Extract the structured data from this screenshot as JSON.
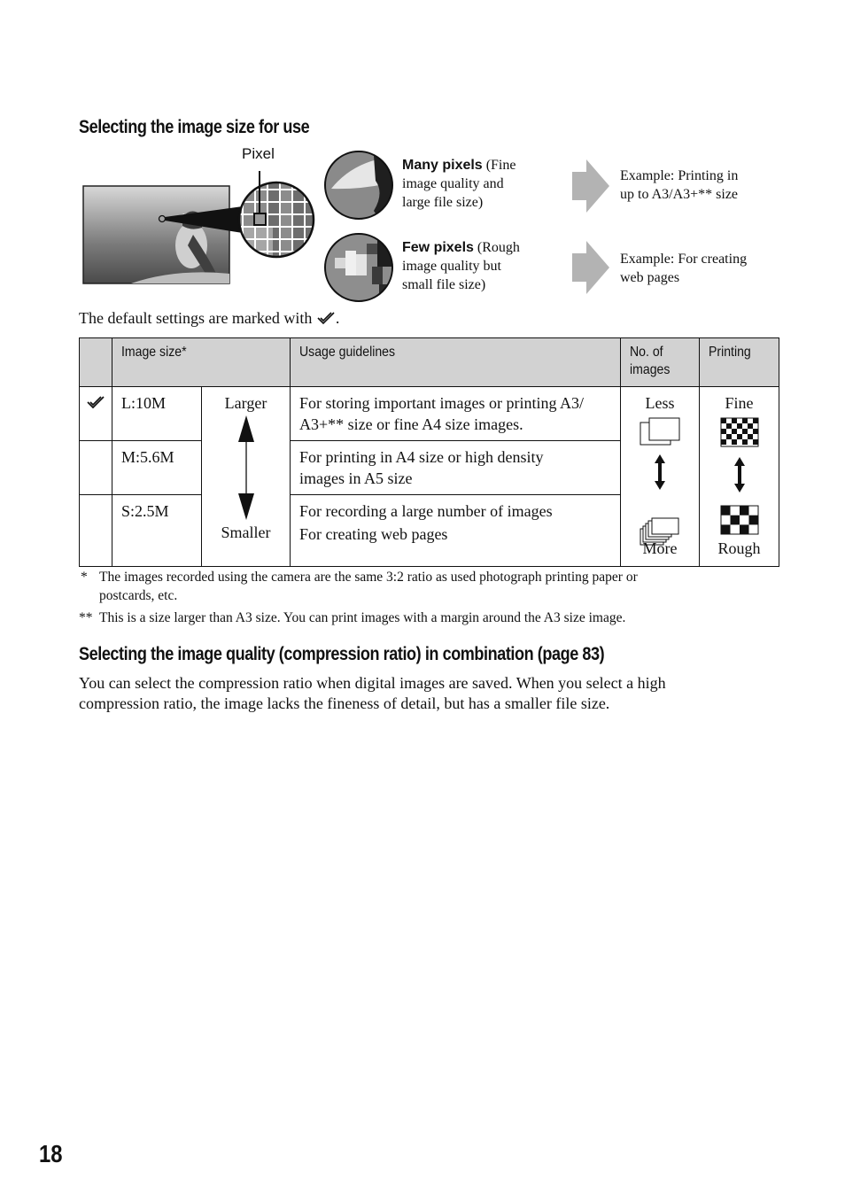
{
  "section1": {
    "heading": "Selecting the image size for use",
    "pixel_label": "Pixel",
    "many": {
      "bold": "Many pixels",
      "rest_line1": " (Fine",
      "rest_line2": "image quality and",
      "rest_line3": "large file size)",
      "example_line1": "Example: Printing in",
      "example_line2": "up to A3/A3+** size"
    },
    "few": {
      "bold": "Few pixels",
      "rest_line1": " (Rough",
      "rest_line2": "image quality but",
      "rest_line3": "small file size)",
      "example_line1": "Example: For creating",
      "example_line2": "web pages"
    },
    "default_note": "The default settings are marked with",
    "default_note_end": "."
  },
  "table": {
    "headers": {
      "image_size": "Image size*",
      "usage": "Usage guidelines",
      "num_images_line1": "No. of",
      "num_images_line2": "images",
      "printing": "Printing"
    },
    "rows": [
      {
        "default": true,
        "size": "L:10M",
        "usage_line1": "For storing important images or printing A3/",
        "usage_line2": "A3+** size or fine A4 size images."
      },
      {
        "default": false,
        "size": "M:5.6M",
        "usage_line1": "For printing in A4 size or high density",
        "usage_line2": "images in A5 size"
      },
      {
        "default": false,
        "size": "S:2.5M",
        "usage_line1": "For recording a large number of images",
        "usage_line2": "For creating web pages"
      }
    ],
    "scale": {
      "top": "Larger",
      "bottom": "Smaller"
    },
    "num_images": {
      "top": "Less",
      "bottom": "More"
    },
    "printing": {
      "top": "Fine",
      "bottom": "Rough"
    }
  },
  "footnotes": [
    {
      "mark": "*",
      "line1": "The images recorded using the camera are the same 3:2 ratio as used photograph printing paper or",
      "line2": "postcards, etc."
    },
    {
      "mark": "**",
      "line1": "This is a size larger than A3 size. You can print images with a margin around the A3 size image."
    }
  ],
  "section2": {
    "heading": "Selecting the image quality (compression ratio) in combination (page 83)",
    "para_line1": "You can select the compression ratio when digital images are saved. When you select a high",
    "para_line2": "compression ratio, the image lacks the fineness of detail, but has a smaller file size."
  },
  "page_number": "18"
}
